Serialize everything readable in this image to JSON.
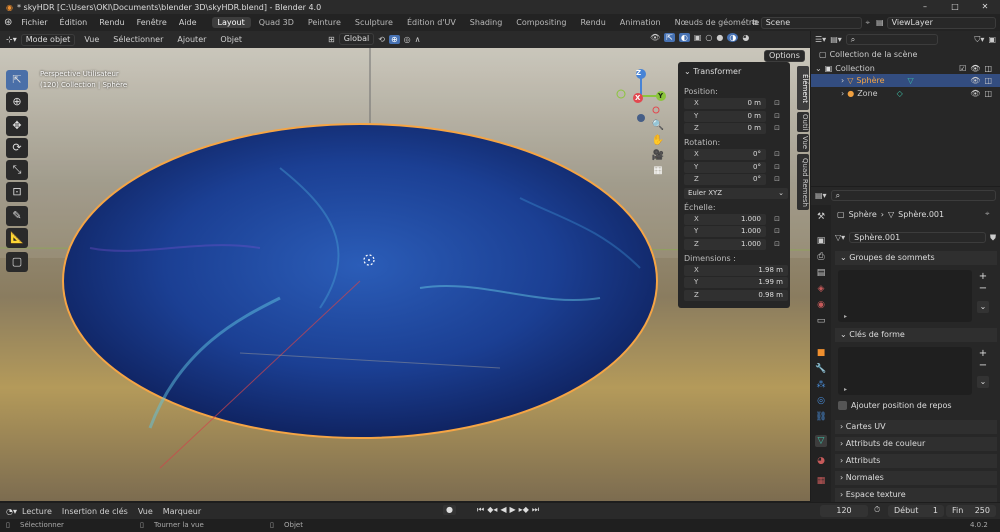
{
  "window": {
    "title": "* skyHDR [C:\\Users\\OKI\\Documents\\blender 3D\\skyHDR.blend] - Blender 4.0",
    "minimize": "–",
    "maximize": "□",
    "close": "✕"
  },
  "topbar": {
    "menus": [
      "Fichier",
      "Édition",
      "Rendu",
      "Fenêtre",
      "Aide"
    ],
    "workspaces": [
      "Layout",
      "Quad 3D",
      "Peinture",
      "Sculpture",
      "Édition d'UV",
      "Shading",
      "Compositing",
      "Rendu",
      "Animation",
      "Nœuds de géométrie"
    ],
    "add_workspace": "+",
    "scene": "Scene",
    "view_layer": "ViewLayer"
  },
  "viewport_header": {
    "mode": "Mode objet",
    "menus": [
      "Vue",
      "Sélectionner",
      "Ajouter",
      "Objet"
    ],
    "orientation": "Global",
    "options": "Options"
  },
  "viewport": {
    "line1": "Perspective Utilisateur",
    "line2": "(120) Collection | Sphère"
  },
  "gizmo": {
    "x": "X",
    "y": "Y",
    "z": "Z"
  },
  "npanel": {
    "title": "Transformer",
    "position_label": "Position:",
    "position": [
      {
        "axis": "X",
        "value": "0 m"
      },
      {
        "axis": "Y",
        "value": "0 m"
      },
      {
        "axis": "Z",
        "value": "0 m"
      }
    ],
    "rotation_label": "Rotation:",
    "rotation": [
      {
        "axis": "X",
        "value": "0°"
      },
      {
        "axis": "Y",
        "value": "0°"
      },
      {
        "axis": "Z",
        "value": "0°"
      }
    ],
    "rotation_mode": "Euler XYZ",
    "scale_label": "Échelle:",
    "scale": [
      {
        "axis": "X",
        "value": "1.000"
      },
      {
        "axis": "Y",
        "value": "1.000"
      },
      {
        "axis": "Z",
        "value": "1.000"
      }
    ],
    "dimensions_label": "Dimensions :",
    "dimensions": [
      {
        "axis": "X",
        "value": "1.98 m"
      },
      {
        "axis": "Y",
        "value": "1.99 m"
      },
      {
        "axis": "Z",
        "value": "0.98 m"
      }
    ],
    "tabs": [
      "Élément",
      "Outil",
      "Vue",
      "Quad Remesh"
    ]
  },
  "outliner": {
    "root": "Collection de la scène",
    "collection": "Collection",
    "items": [
      {
        "name": "Sphère"
      },
      {
        "name": "Zone"
      }
    ]
  },
  "properties": {
    "breadcrumb_object": "Sphère",
    "breadcrumb_data": "Sphère.001",
    "mesh_name": "Sphère.001",
    "sections": {
      "vertex_groups": "Groupes de sommets",
      "shape_keys": "Clés de forme",
      "rest_position": "Ajouter position de repos",
      "uv_maps": "Cartes UV",
      "color_attributes": "Attributs de couleur",
      "attributes": "Attributs",
      "normals": "Normales",
      "texture_space": "Espace texture"
    }
  },
  "timeline": {
    "menus": [
      "Lecture",
      "Insertion de clés",
      "Vue",
      "Marqueur"
    ],
    "current_frame": "120",
    "start_label": "Début",
    "start": "1",
    "end_label": "Fin",
    "end": "250"
  },
  "status": {
    "select": "Sélectionner",
    "rotate": "Tourner la vue",
    "object": "Objet",
    "version": "4.0.2"
  },
  "colors": {
    "accent": "#4772b3",
    "selection": "#f5a545",
    "x_axis": "#e2484f",
    "y_axis": "#8bc53d",
    "z_axis": "#4783d6"
  }
}
